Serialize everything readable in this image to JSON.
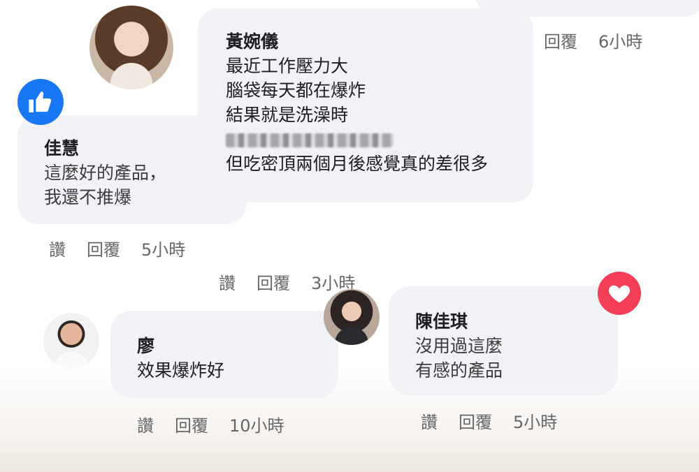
{
  "comments": [
    {
      "author": "黃婉儀",
      "lines": [
        "最近工作壓力大",
        "腦袋每天都在爆炸",
        "結果就是洗澡時",
        "但吃密頂兩個月後感覺真的差很多"
      ],
      "redacted_line": true,
      "actions": {
        "reply": "回覆",
        "time": "6小時"
      }
    },
    {
      "author": "佳慧",
      "lines": [
        "這麼好的產品，",
        "我還不推爆"
      ],
      "reaction": "like-icon",
      "actions": {
        "like": "讚",
        "reply": "回覆",
        "time": "5小時"
      }
    },
    {
      "author": "",
      "actions": {
        "like": "讚",
        "reply": "回覆",
        "time": "3小時"
      }
    },
    {
      "author": "廖",
      "lines": [
        "效果爆炸好"
      ],
      "actions": {
        "like": "讚",
        "reply": "回覆",
        "time": "10小時"
      }
    },
    {
      "author": "陳佳琪",
      "lines": [
        "沒用過這麼",
        "有感的產品"
      ],
      "reaction": "love-icon",
      "actions": {
        "like": "讚",
        "reply": "回覆",
        "time": "5小時"
      }
    }
  ],
  "colors": {
    "bubble": "#f0f2f5",
    "meta": "#65676b",
    "like": "#1877f2",
    "love": "#f33e58"
  }
}
